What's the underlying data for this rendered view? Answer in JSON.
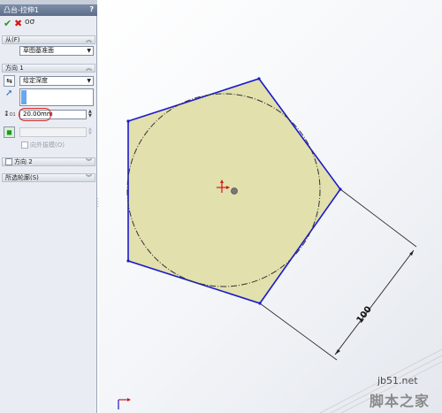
{
  "feature_manager": {
    "title": "凸台-拉伸1",
    "help": "?",
    "ok_icon": "checkmark-icon",
    "cancel_icon": "x-icon",
    "detail_preview_icon": "glasses-icon"
  },
  "from_section": {
    "label": "从(F)",
    "start_condition": "草图基准面"
  },
  "direction1": {
    "label": "方向 1",
    "end_condition": "给定深度",
    "depth": "20.00mm",
    "draft_outward": "向外拔模(O)"
  },
  "direction2": {
    "label": "方向 2"
  },
  "selected_contours": {
    "label": "所选轮廓(S)"
  },
  "sketch": {
    "dimension_value": "100",
    "accent_color": "#1a1acc",
    "fill_color": "#e2e0ad",
    "centerline_color": "#333333"
  },
  "watermark": {
    "site": "jb51.net",
    "name": "脚本之家"
  }
}
